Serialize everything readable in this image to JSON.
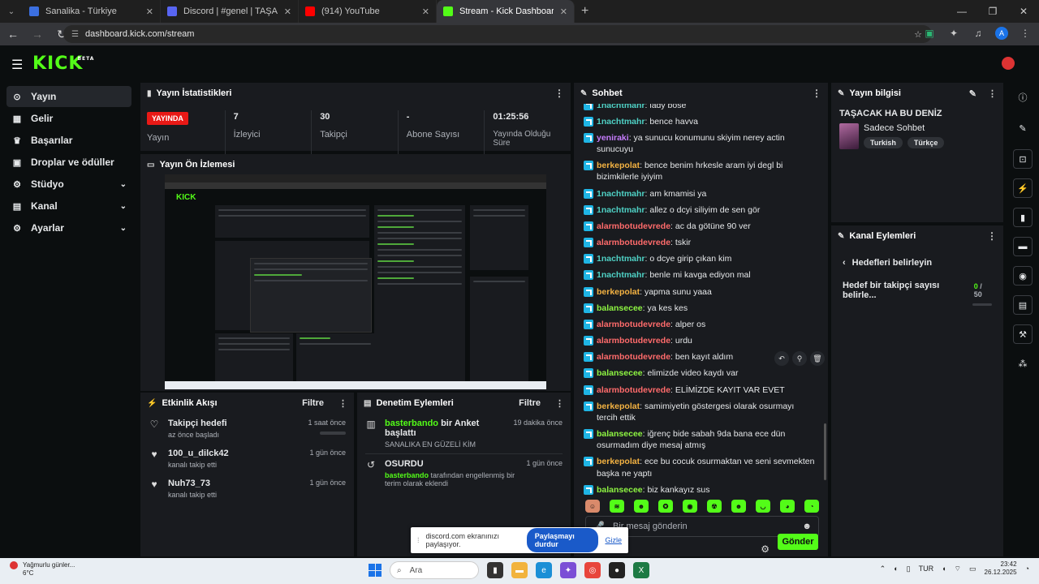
{
  "browser": {
    "tabs": [
      {
        "title": "Sanalika - Türkiye",
        "color": "#3b6fe0"
      },
      {
        "title": "Discord | #genel | TAŞACAK",
        "color": "#5865f2"
      },
      {
        "title": "(914) YouTube",
        "color": "#ff0000"
      },
      {
        "title": "Stream - Kick Dashboard",
        "color": "#53fc18"
      }
    ],
    "url": "dashboard.kick.com/stream"
  },
  "header": {
    "logo": "KICK",
    "logo_badge": "BETA"
  },
  "sidebar": {
    "items": [
      {
        "label": "Yayın",
        "icon": "broadcast-icon",
        "glyph": "⊙",
        "chevron": false
      },
      {
        "label": "Gelir",
        "icon": "revenue-icon",
        "glyph": "▦",
        "chevron": false
      },
      {
        "label": "Başarılar",
        "icon": "trophy-icon",
        "glyph": "♛",
        "chevron": false
      },
      {
        "label": "Droplar ve ödüller",
        "icon": "gift-icon",
        "glyph": "▣",
        "chevron": false
      },
      {
        "label": "Stüdyo",
        "icon": "studio-icon",
        "glyph": "⚙",
        "chevron": true
      },
      {
        "label": "Kanal",
        "icon": "channel-icon",
        "glyph": "▤",
        "chevron": true
      },
      {
        "label": "Ayarlar",
        "icon": "settings-icon",
        "glyph": "⚙",
        "chevron": true
      }
    ]
  },
  "stats": {
    "title": "Yayın İstatistikleri",
    "live_label": "YAYINDA",
    "status_label": "Yayın",
    "viewers_value": "7",
    "viewers_label": "İzleyici",
    "followers_value": "30",
    "followers_label": "Takipçi",
    "subs_value": "-",
    "subs_label": "Abone Sayısı",
    "uptime_value": "01:25:56",
    "uptime_label": "Yayında Olduğu Süre"
  },
  "preview": {
    "title": "Yayın Ön İzlemesi"
  },
  "activity": {
    "title": "Etkinlik Akışı",
    "filter": "Filtre",
    "items": [
      {
        "title": "Takipçi hedefi",
        "sub": "az önce başladı",
        "time": "1 saat önce",
        "icon": "heart-outline-icon",
        "glyph": "♡"
      },
      {
        "title": "100_u_dilck42",
        "sub": "kanalı takip etti",
        "time": "1 gün önce",
        "icon": "heart-icon",
        "glyph": "♥"
      },
      {
        "title": "Nuh73_73",
        "sub": "kanalı takip etti",
        "time": "1 gün önce",
        "icon": "heart-icon",
        "glyph": "♥"
      }
    ]
  },
  "moderation": {
    "title": "Denetim Eylemleri",
    "filter": "Filtre",
    "items": [
      {
        "user": "basterbando",
        "action": " bir Anket başlattı",
        "sub": "SANALIKA EN GÜZELİ KİM",
        "time": "19 dakika önce",
        "icon": "poll-icon"
      },
      {
        "title": "OSURDU",
        "user": "basterbando",
        "sub": " tarafından engellenmiş bir terim olarak eklendi",
        "time": "1 gün önce",
        "icon": "undo-icon"
      }
    ]
  },
  "chat": {
    "title": "Sohbet",
    "messages": [
      {
        "user": "1nachtmahr",
        "color": "#4fd1c5",
        "text": "lady bose"
      },
      {
        "user": "1nachtmahr",
        "color": "#4fd1c5",
        "text": "bence havva"
      },
      {
        "user": "yeniraki",
        "color": "#c77dff",
        "text": "ya sunucu konumunu skiyim nerey actin sunucuyu"
      },
      {
        "user": "berkepolat",
        "color": "#f5b342",
        "text": "bence benim hrkesle aram iyi degl bi bizimkilerle iyiyim"
      },
      {
        "user": "1nachtmahr",
        "color": "#4fd1c5",
        "text": "am kmamisi ya"
      },
      {
        "user": "1nachtmahr",
        "color": "#4fd1c5",
        "text": "allez o dcyi siliyim de sen gör"
      },
      {
        "user": "alarmbotudevrede",
        "color": "#ff6b6b",
        "text": "ac da götüne 90 ver"
      },
      {
        "user": "alarmbotudevrede",
        "color": "#ff6b6b",
        "text": "tskir"
      },
      {
        "user": "1nachtmahr",
        "color": "#4fd1c5",
        "text": "o dcye girip çıkan kim"
      },
      {
        "user": "1nachtmahr",
        "color": "#4fd1c5",
        "text": "benle mi kavga ediyon mal"
      },
      {
        "user": "berkepolat",
        "color": "#f5b342",
        "text": "yapma sunu yaaa"
      },
      {
        "user": "balansecee",
        "color": "#8ef542",
        "text": "ya kes kes"
      },
      {
        "user": "alarmbotudevrede",
        "color": "#ff6b6b",
        "text": "alper os"
      },
      {
        "user": "alarmbotudevrede",
        "color": "#ff6b6b",
        "text": "urdu"
      },
      {
        "user": "alarmbotudevrede",
        "color": "#ff6b6b",
        "text": "ben kayıt aldım"
      },
      {
        "user": "balansecee",
        "color": "#8ef542",
        "text": "elimizde video kaydı var"
      },
      {
        "user": "alarmbotudevrede",
        "color": "#ff6b6b",
        "text": "ELİMİZDE KAYIT VAR EVET"
      },
      {
        "user": "berkepolat",
        "color": "#f5b342",
        "text": "samimiyetin göstergesi olarak osurmayı tercih ettik"
      },
      {
        "user": "balansecee",
        "color": "#8ef542",
        "text": "iğrenç bide sabah 9da bana ece dün osurmadım diye mesaj atmış"
      },
      {
        "user": "berkepolat",
        "color": "#f5b342",
        "text": "ece bu cocuk osurmaktan ve seni sevmekten başka ne yaptı"
      },
      {
        "user": "balansecee",
        "color": "#8ef542",
        "text": "biz kankayız sus"
      }
    ],
    "input_placeholder": "Bir mesaj gönderin",
    "send_label": "Gönder"
  },
  "stream_info": {
    "title": "Yayın bilgisi",
    "stream_title": "TAŞACAK HA BU DENİZ",
    "category": "Sadece Sohbet",
    "tags": [
      "Turkish",
      "Türkçe"
    ]
  },
  "channel_actions": {
    "title": "Kanal Eylemleri",
    "back_label": "Hedefleri belirleyin",
    "goal_label": "Hedef bir takipçi sayısı belirle...",
    "goal_current": "0",
    "goal_total": " / 50"
  },
  "share_banner": {
    "text": "discord.com ekranınızı paylaşıyor.",
    "stop_label": "Paylaşmayı durdur",
    "hide_label": "Gizle"
  },
  "taskbar": {
    "weather_title": "Yağmurlu günler...",
    "weather_temp": "6°C",
    "search_placeholder": "Ara",
    "lang": "TUR",
    "time": "23:42",
    "date": "26.12.2025"
  }
}
